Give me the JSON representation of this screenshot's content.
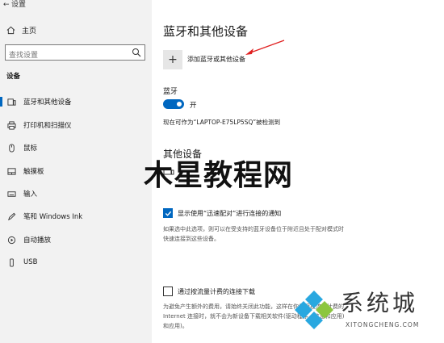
{
  "window": {
    "title": "设置"
  },
  "sidebar": {
    "home_label": "主页",
    "search_placeholder": "查找设置",
    "section_label": "设备",
    "items": [
      {
        "label": "蓝牙和其他设备",
        "icon": "bluetooth-devices-icon",
        "selected": true
      },
      {
        "label": "打印机和扫描仪",
        "icon": "printer-icon",
        "selected": false
      },
      {
        "label": "鼠标",
        "icon": "mouse-icon",
        "selected": false
      },
      {
        "label": "触摸板",
        "icon": "touchpad-icon",
        "selected": false
      },
      {
        "label": "输入",
        "icon": "keyboard-icon",
        "selected": false
      },
      {
        "label": "笔和 Windows Ink",
        "icon": "pen-icon",
        "selected": false
      },
      {
        "label": "自动播放",
        "icon": "autoplay-icon",
        "selected": false
      },
      {
        "label": "USB",
        "icon": "usb-icon",
        "selected": false
      }
    ]
  },
  "main": {
    "title": "蓝牙和其他设备",
    "add_device_label": "添加蓝牙或其他设备",
    "bluetooth": {
      "label": "蓝牙",
      "toggle_state": "开",
      "discoverable_text": "现在可作为“LAPTOP-E75LP5SQ”被检测到"
    },
    "other_devices_title": "其他设备",
    "swift_pair": {
      "label": "显示使用“迅速配对”进行连接的通知",
      "checked": true,
      "description_line1": "如果选中此选项，则可以在受支持的蓝牙设备位于附近且处于配对模式时",
      "description_line2": "快速连接到这些设备。"
    },
    "metered": {
      "label": "通过按流量计费的连接下载",
      "checked": false,
      "description_line1": "为避免产生额外的费用，请始终关闭此功能，这样在你使用按流量计费的",
      "description_line2": "Internet 连接时，就不会为新设备下载相关软件(驱动程序、信息和应用)",
      "description_line3": "和应用)。"
    }
  },
  "watermarks": {
    "center_text": "木星教程网",
    "logo_text": "系统城",
    "logo_sub": "XITONGCHENG.COM"
  },
  "colors": {
    "accent": "#0067c0",
    "sidebar_bg": "#f2f2f2",
    "arrow": "#e02020"
  }
}
